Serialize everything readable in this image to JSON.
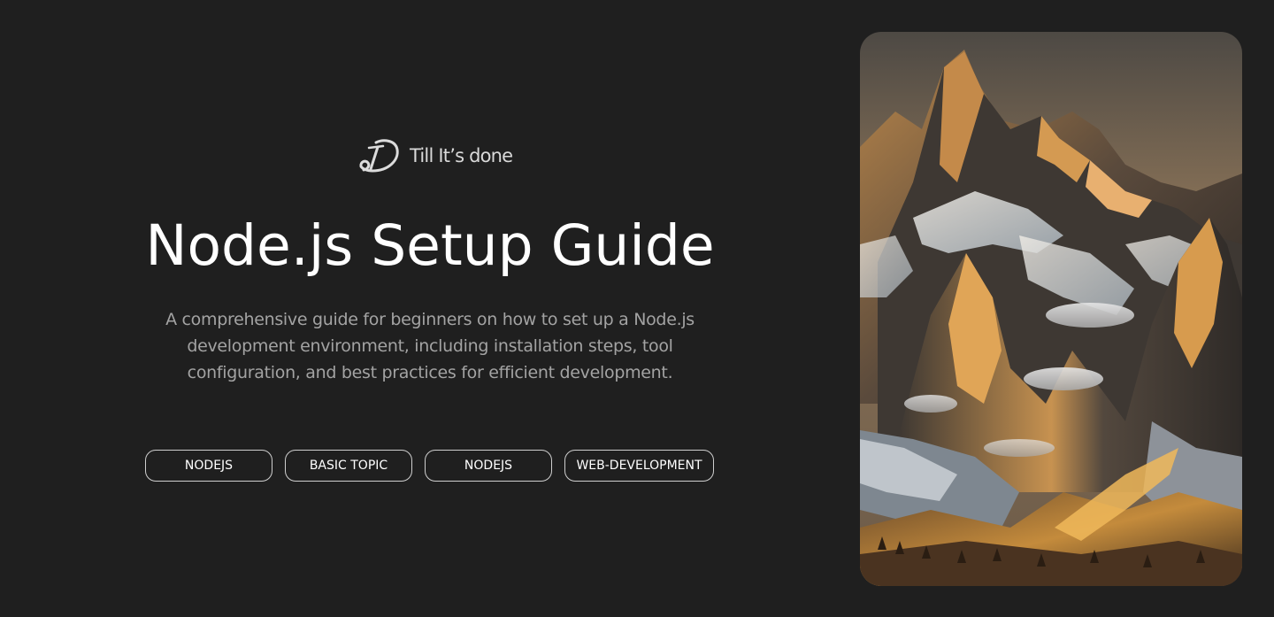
{
  "brand": {
    "logo_icon": "brand-logo-icon",
    "name": "Till It’s done"
  },
  "hero": {
    "title": "Node.js Setup Guide",
    "description": "A comprehensive guide for beginners on how to set up a Node.js development environment, including installation steps, tool configuration, and best practices for efficient development."
  },
  "tags": [
    {
      "label": "NODEJS"
    },
    {
      "label": "BASIC TOPIC"
    },
    {
      "label": "NODEJS"
    },
    {
      "label": "WEB-DEVELOPMENT"
    }
  ],
  "image": {
    "subject": "mountain-landscape-image"
  },
  "colors": {
    "background": "#1f1f1f",
    "title": "#ffffff",
    "description": "#a3a3a3",
    "tag_border": "#cfcfcf"
  }
}
